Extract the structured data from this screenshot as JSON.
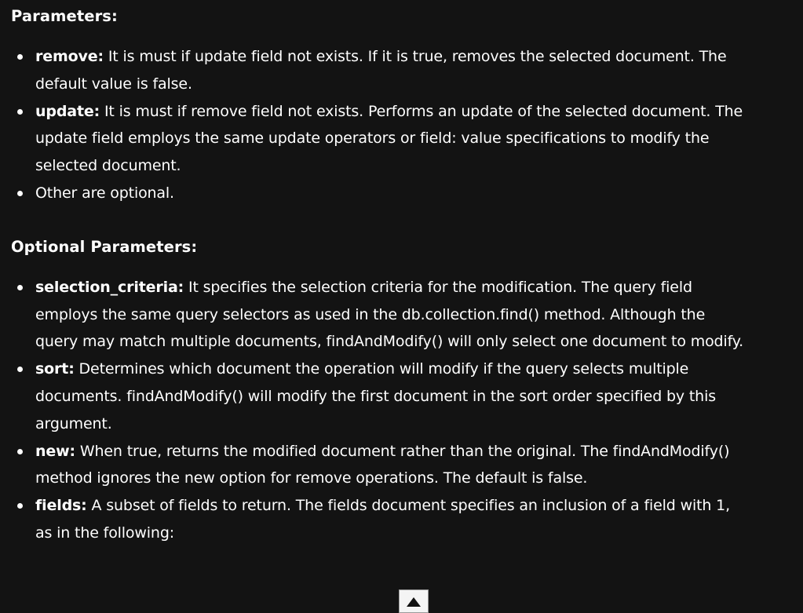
{
  "parameters": {
    "heading": "Parameters:",
    "items": [
      {
        "term": "remove:",
        "text": " It is must if update field not exists. If it is true, removes the selected document. The default value is false."
      },
      {
        "term": "update:",
        "text": " It is must if remove field not exists. Performs an update of the selected document. The update field employs the same update operators or field: value specifications to modify the selected document."
      },
      {
        "term": "",
        "text": "Other are optional."
      }
    ]
  },
  "optional_parameters": {
    "heading": "Optional Parameters:",
    "items": [
      {
        "term": "selection_criteria:",
        "text": " It specifies the selection criteria for the modification. The query field employs the same query selectors as used in the db.collection.find() method. Although the query may match multiple documents, findAndModify() will only select one document to modify."
      },
      {
        "term": "sort:",
        "text": " Determines which document the operation will modify if the query selects multiple documents. findAndModify() will modify the first document in the sort order specified by this argument."
      },
      {
        "term": "new:",
        "text": " When true, returns the modified document rather than the original. The findAndModify() method ignores the new option for remove operations. The default is false."
      },
      {
        "term": "fields:",
        "text": " A subset of fields to return. The fields document specifies an inclusion of a field with 1, as in the following:"
      }
    ]
  },
  "scroll_top_button": {
    "icon": "arrow-up-icon"
  }
}
